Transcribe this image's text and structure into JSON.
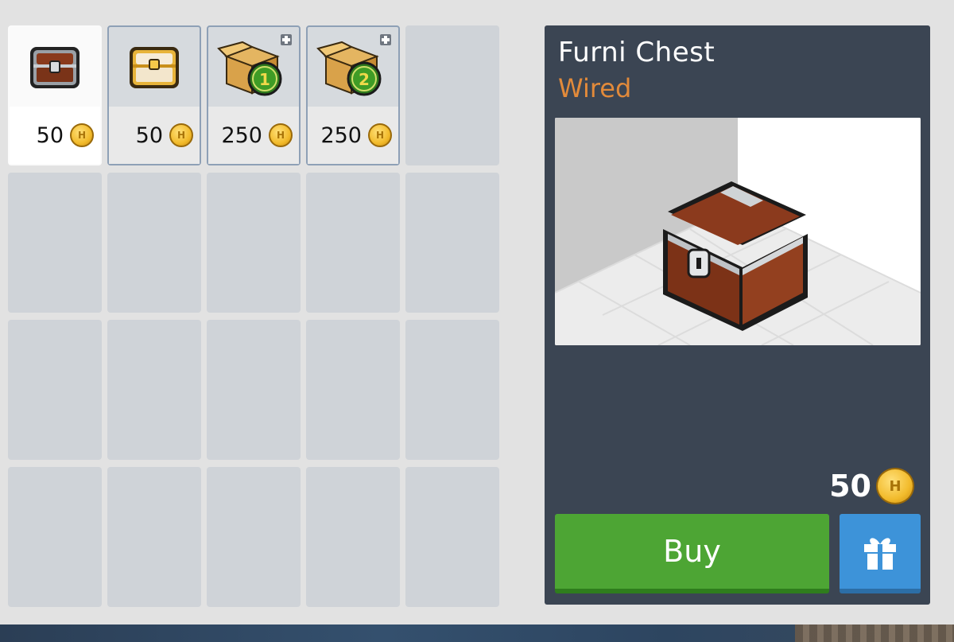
{
  "catalog": {
    "items": [
      {
        "name": "Wired chest",
        "price": "50",
        "icon": "furni-chest-icon",
        "selected": true
      },
      {
        "name": "Gold chest",
        "price": "50",
        "icon": "gold-chest-icon",
        "selected": false
      },
      {
        "name": "Box bundle 1",
        "price": "250",
        "icon": "box-bundle-icon",
        "badge": "1",
        "selected": false
      },
      {
        "name": "Box bundle 2",
        "price": "250",
        "icon": "box-bundle-icon",
        "badge": "2",
        "selected": false
      }
    ],
    "empty_slots": 16,
    "currency_icon": "habbo-credit-coin-icon"
  },
  "preview": {
    "title": "Furni Chest",
    "subtitle": "Wired",
    "price": "50",
    "buy_label": "Buy",
    "gift_icon": "gift-icon"
  },
  "colors": {
    "panel_bg": "#3b4553",
    "subtitle": "#e28a3a",
    "buy": "#4da534",
    "gift": "#3d93d9"
  }
}
